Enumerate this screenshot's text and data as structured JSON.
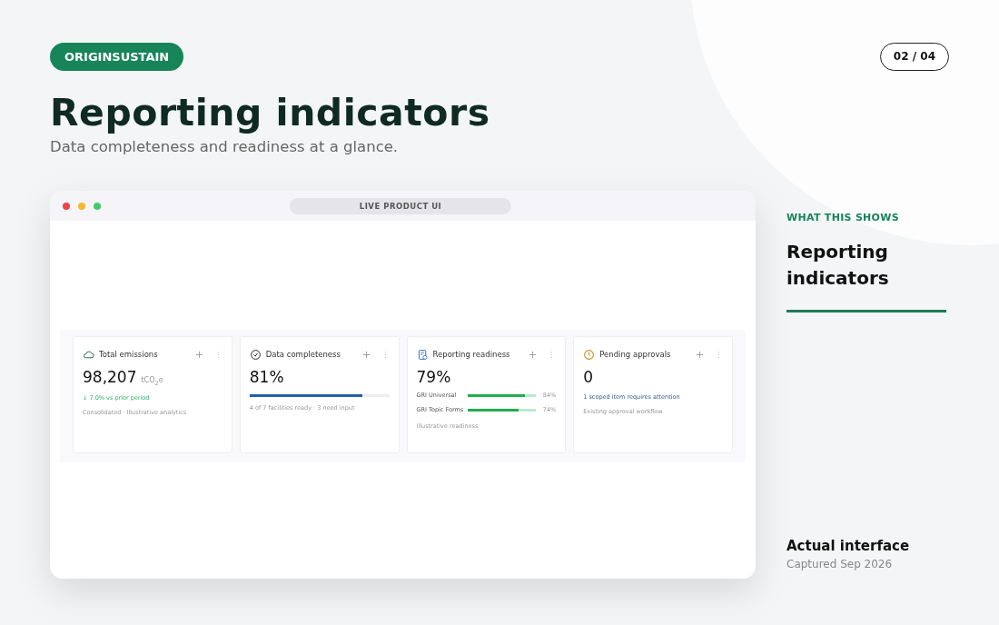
{
  "brand": "ORIGINSUSTAIN",
  "page_indicator": "02 / 04",
  "title": "Reporting indicators",
  "subtitle": "Data completeness and readiness at a glance.",
  "browser": {
    "address": "LIVE PRODUCT UI",
    "cards": [
      {
        "kind": "metric",
        "title": "Total emissions",
        "value": "98,207",
        "unit": "tCO$_{2}$e",
        "delta": "↓ 7.0% vs prior period",
        "note": "Consolidated · Illustrative analytics"
      },
      {
        "kind": "progress",
        "title": "Data completeness",
        "value": "81%",
        "level": 0.81,
        "note": "4 of 7 facilities ready · 3 need input"
      },
      {
        "kind": "breakdown",
        "title": "Reporting readiness",
        "value": "79%",
        "rows": [
          {
            "label": "GRI Universal",
            "level": 0.84,
            "reading": "84%"
          },
          {
            "label": "GRI Topic Forms",
            "level": 0.74,
            "reading": "74%"
          }
        ],
        "note": "Illustrative readiness"
      },
      {
        "kind": "alert",
        "title": "Pending approvals",
        "value": "0",
        "link": "1 scoped item requires attention",
        "note": "Existing approval workflow"
      }
    ]
  },
  "side": {
    "eyebrow": "WHAT THIS SHOWS",
    "heading": "Reporting indicators",
    "footer_title": "Actual interface",
    "footer_caption": "Captured Sep 2026"
  }
}
